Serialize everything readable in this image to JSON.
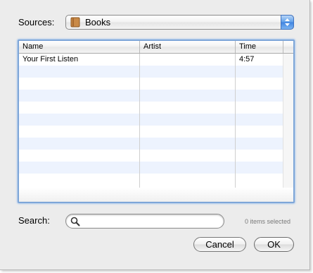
{
  "sources": {
    "label": "Sources:",
    "selected": "Books",
    "icon": "book-icon"
  },
  "table": {
    "columns": [
      "Name",
      "Artist",
      "Time"
    ],
    "rows": [
      {
        "name": "Your First Listen",
        "artist": "",
        "time": "4:57"
      }
    ]
  },
  "search": {
    "label": "Search:",
    "value": "",
    "placeholder": ""
  },
  "status": "0 items selected",
  "buttons": {
    "cancel": "Cancel",
    "ok": "OK"
  },
  "colors": {
    "selection_ring": "#7ea6d8",
    "alt_row": "#edf3fe",
    "stepper": "#3f83e0"
  }
}
